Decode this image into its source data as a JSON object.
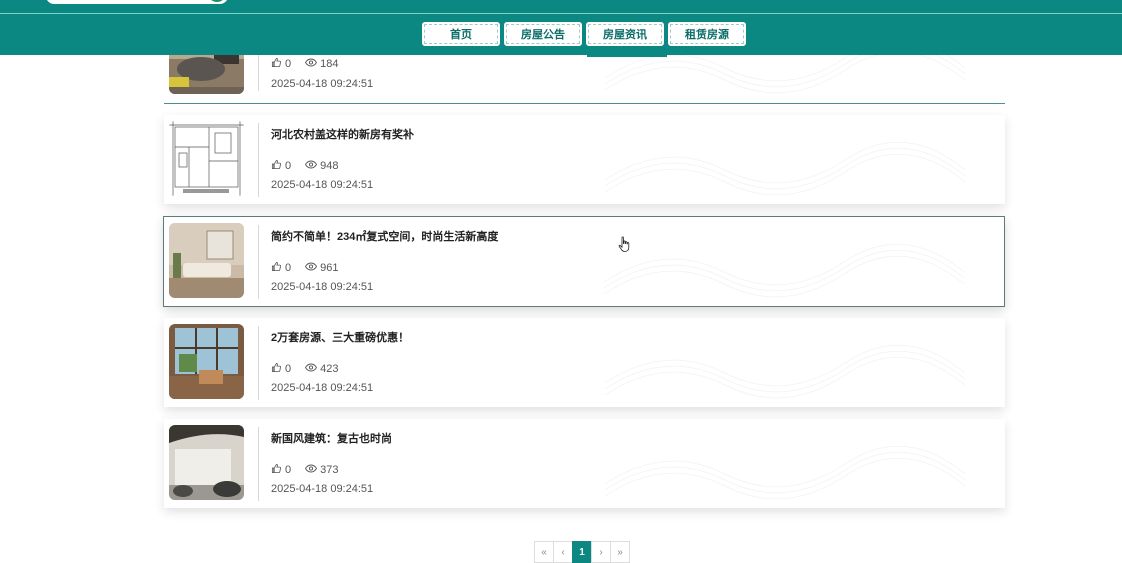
{
  "nav": {
    "items": [
      {
        "label": "首页"
      },
      {
        "label": "房屋公告"
      },
      {
        "label": "房屋资讯"
      },
      {
        "label": "租赁房源"
      }
    ],
    "active": "房屋资讯"
  },
  "news": [
    {
      "title": "",
      "likes": "0",
      "views": "184",
      "date": "2025-04-18 09:24:51",
      "thumb": "living-room-image"
    },
    {
      "title": "河北农村盖这样的新房有奖补",
      "likes": "0",
      "views": "948",
      "date": "2025-04-18 09:24:51",
      "thumb": "floor-plan-image"
    },
    {
      "title": "简约不简单！234㎡复式空间，时尚生活新高度",
      "likes": "0",
      "views": "961",
      "date": "2025-04-18 09:24:51",
      "thumb": "bedroom-image"
    },
    {
      "title": "2万套房源、三大重磅优惠！",
      "likes": "0",
      "views": "423",
      "date": "2025-04-18 09:24:51",
      "thumb": "sunroom-image"
    },
    {
      "title": "新国风建筑：复古也时尚",
      "likes": "0",
      "views": "373",
      "date": "2025-04-18 09:24:51",
      "thumb": "courtyard-image"
    }
  ],
  "pagination": {
    "first": "«",
    "prev": "‹",
    "current": "1",
    "next": "›",
    "last": "»"
  },
  "colors": {
    "brand": "#0b8882"
  }
}
